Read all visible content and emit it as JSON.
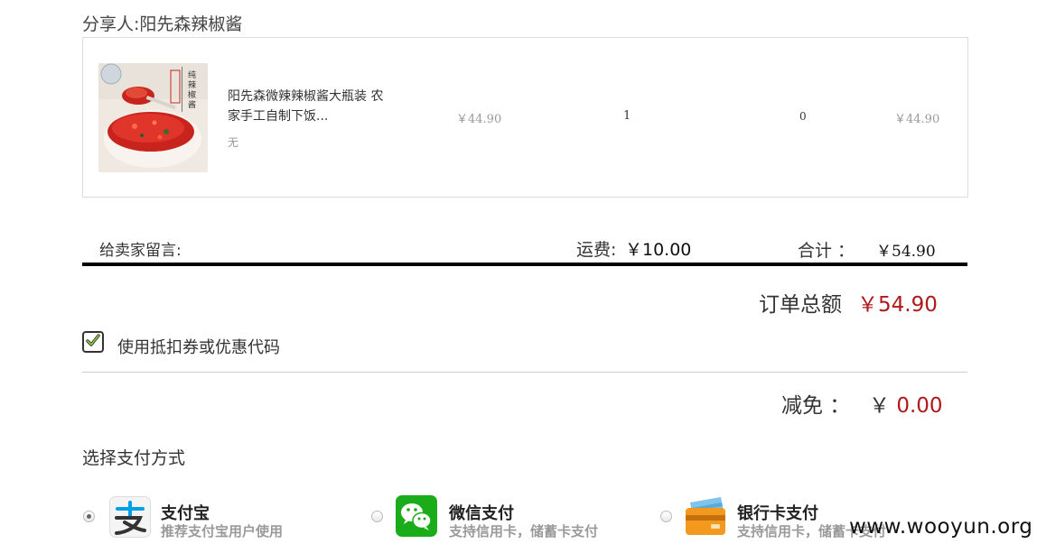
{
  "sharer": "分享人:阳先森辣椒酱",
  "item": {
    "title": "阳先森微辣辣椒酱大瓶装 农家手工自制下饭...",
    "spec": "无",
    "unit_price": "￥44.90",
    "quantity": "1",
    "discount": "0",
    "subtotal": "￥44.90",
    "image_icon": "chili-sauce-product-photo"
  },
  "summary": {
    "message_label": "给卖家留言:",
    "shipping_label": "运费:",
    "shipping_value": "￥10.00",
    "total_label": "合计 ：",
    "total_value": "￥54.90",
    "order_total_label": "订单总额",
    "order_total_value": "￥54.90"
  },
  "coupon": {
    "checked": true,
    "label": "使用抵扣券或优惠代码"
  },
  "reduction": {
    "label": "减免 ：",
    "currency": "￥",
    "value": "0.00"
  },
  "payment": {
    "title": "选择支付方式",
    "methods": [
      {
        "icon": "alipay-icon",
        "name": "支付宝",
        "desc": "推荐支付宝用户使用",
        "selected": true
      },
      {
        "icon": "wechat-pay-icon",
        "name": "微信支付",
        "desc": "支持信用卡，储蓄卡支付",
        "selected": false
      },
      {
        "icon": "bank-card-icon",
        "name": "银行卡支付",
        "desc": "支持信用卡，储蓄卡支付",
        "selected": false
      }
    ]
  },
  "watermark": "www.wooyun.org",
  "colors": {
    "price_red": "#b0191b",
    "alipay_blue": "#00a0e9",
    "wechat_green": "#1aad19",
    "bank_orange": "#f39a1e"
  }
}
